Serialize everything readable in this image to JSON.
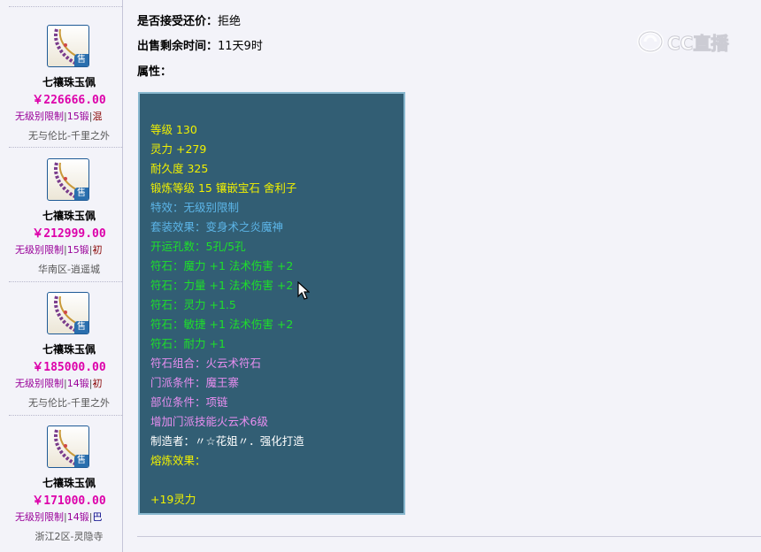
{
  "sidebar": {
    "items": [
      {
        "name": "七禳珠玉佩",
        "price": "￥226666.00",
        "tag_limit": "无级别限制",
        "tag_forge": "15锻",
        "tag_extra": "混",
        "server": "无与伦比-千里之外",
        "badge": "售"
      },
      {
        "name": "七禳珠玉佩",
        "price": "￥212999.00",
        "tag_limit": "无级别限制",
        "tag_forge": "15锻",
        "tag_extra": "初",
        "server": "华南区-逍遥城",
        "badge": "售"
      },
      {
        "name": "七禳珠玉佩",
        "price": "￥185000.00",
        "tag_limit": "无级别限制",
        "tag_forge": "14锻",
        "tag_extra": "初",
        "server": "无与伦比-千里之外",
        "badge": "售"
      },
      {
        "name": "七禳珠玉佩",
        "price": "￥171000.00",
        "tag_limit": "无级别限制",
        "tag_forge": "14锻",
        "tag_extra": "巴",
        "server": "浙江2区-灵隐寺",
        "badge": "售"
      }
    ],
    "separator": "|"
  },
  "main": {
    "counter_offer_label": "是否接受还价：",
    "counter_offer_value": "拒绝",
    "time_left_label": "出售剩余时间：",
    "time_left_value": "11天9时",
    "attributes_label": "属性："
  },
  "attributes": {
    "lines": [
      {
        "text": "等级 130",
        "color": "yellow"
      },
      {
        "text": "灵力 +279",
        "color": "yellow"
      },
      {
        "text": "耐久度 325",
        "color": "yellow"
      },
      {
        "text": "锻炼等级 15 镶嵌宝石 舍利子",
        "color": "yellow"
      },
      {
        "text": "特效：无级别限制",
        "color": "blue"
      },
      {
        "text": "套装效果：变身术之炎魔神",
        "color": "blue"
      },
      {
        "text": "开运孔数：5孔/5孔",
        "color": "green"
      },
      {
        "text": "符石：魔力 +1 法术伤害 +2",
        "color": "green"
      },
      {
        "text": "符石：力量 +1 法术伤害 +2",
        "color": "green"
      },
      {
        "text": "符石：灵力 +1.5",
        "color": "green"
      },
      {
        "text": "符石：敏捷 +1 法术伤害 +2",
        "color": "green"
      },
      {
        "text": "符石：耐力 +1",
        "color": "green"
      },
      {
        "text": "符石组合：火云术符石",
        "color": "purple"
      },
      {
        "text": "门派条件：魔王寨",
        "color": "purple"
      },
      {
        "text": "部位条件：项链",
        "color": "purple"
      },
      {
        "text": "增加门派技能火云术6级",
        "color": "purple"
      },
      {
        "text": "制造者：〃☆花姐〃．强化打造",
        "color": "white"
      },
      {
        "text": "熔炼效果：",
        "color": "yellow"
      },
      {
        "text": "",
        "color": "yellow"
      },
      {
        "text": "+19灵力",
        "color": "yellow"
      }
    ]
  },
  "watermark": {
    "text": "CC直播"
  },
  "colors": {
    "panel_bg": "#325e74",
    "panel_border": "#89b8cf",
    "price": "#dd00aa",
    "yellow": "#f0f000",
    "blue": "#5cb5e8",
    "green": "#1ee02a",
    "purple": "#e88ef0",
    "white": "#ffffff"
  },
  "icons": {
    "item_thumbnail": "jade-pendant-necklace-icon",
    "watermark_logo": "cc-live-logo-icon",
    "cursor": "mouse-pointer-icon"
  }
}
